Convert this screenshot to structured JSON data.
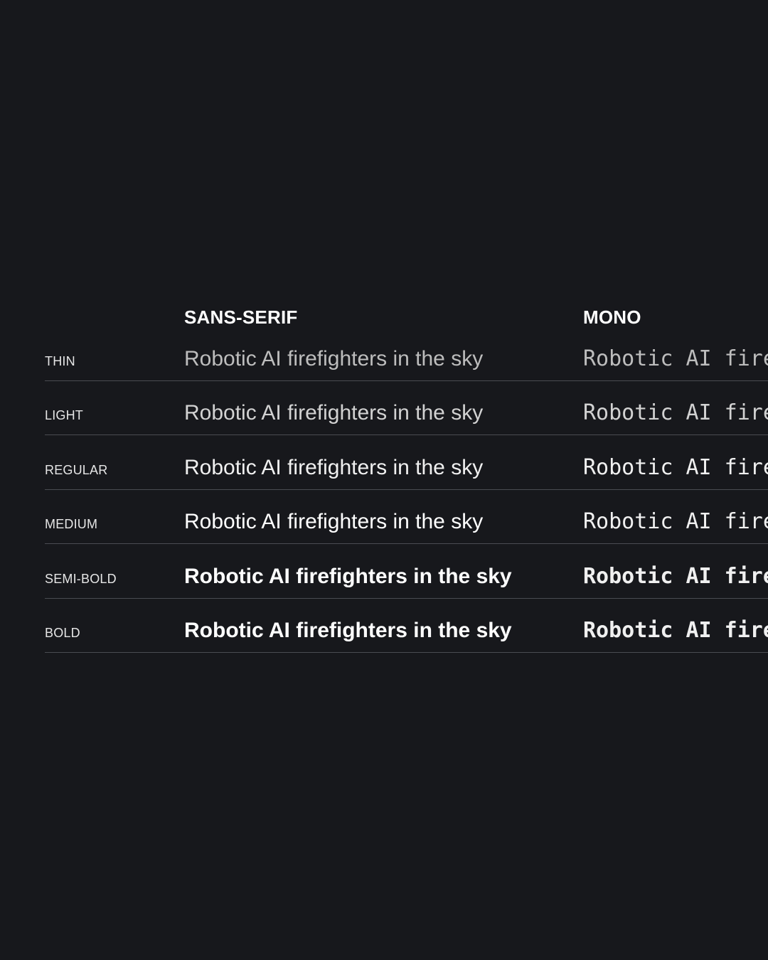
{
  "columns": {
    "sans": "SANS-SERIF",
    "mono": "MONO"
  },
  "rows": [
    {
      "label": "THIN",
      "sample": "Robotic AI firefighters in the sky",
      "mono_sample": "Robotic AI firefighters in the sky"
    },
    {
      "label": "LIGHT",
      "sample": "Robotic AI firefighters in the sky",
      "mono_sample": "Robotic AI firefighters in the sky"
    },
    {
      "label": "REGULAR",
      "sample": "Robotic AI firefighters in the sky",
      "mono_sample": "Robotic AI firefighters in the sky"
    },
    {
      "label": "MEDIUM",
      "sample": "Robotic AI firefighters in the sky",
      "mono_sample": "Robotic AI firefighters in the sky"
    },
    {
      "label": "SEMI-BOLD",
      "sample": "Robotic AI firefighters in the sky",
      "mono_sample": "Robotic AI firefighters in the sky"
    },
    {
      "label": "BOLD",
      "sample": "Robotic AI firefighters in the sky",
      "mono_sample": "Robotic AI firefighters in the sky"
    }
  ],
  "colors": {
    "background": "#17181c",
    "text": "#f2f2f2",
    "divider": "#4a4c52"
  }
}
